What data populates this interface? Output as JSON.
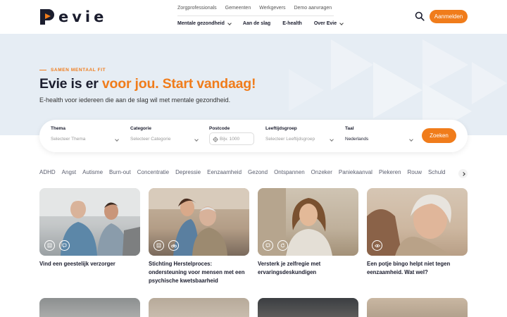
{
  "header": {
    "logo_text": "evie",
    "top_links": [
      "Zorgprofessionals",
      "Gemeenten",
      "Werkgevers",
      "Demo aanvragen"
    ],
    "main_nav": [
      {
        "label": "Mentale gezondheid",
        "has_dropdown": true
      },
      {
        "label": "Aan de slag",
        "has_dropdown": false
      },
      {
        "label": "E-health",
        "has_dropdown": false
      },
      {
        "label": "Over Evie",
        "has_dropdown": true
      }
    ],
    "search_icon": "search-icon",
    "signup_label": "Aanmelden"
  },
  "hero": {
    "eyebrow": "SAMEN MENTAAL FIT",
    "title_plain": "Evie is er ",
    "title_accent": "voor jou. Start vandaag!",
    "subtitle": "E-health voor iedereen die aan de slag wil met mentale gezondheid."
  },
  "search": {
    "fields": [
      {
        "label": "Thema",
        "placeholder": "Selecteer Thema"
      },
      {
        "label": "Categorie",
        "placeholder": "Selecteer Categorie"
      },
      {
        "label": "Postcode",
        "placeholder": "Bijv. 1000"
      },
      {
        "label": "Leeftijdsgroep",
        "placeholder": "Selecteer Leeftijdsgroep"
      },
      {
        "label": "Taal",
        "value": "Nederlands"
      }
    ],
    "button_label": "Zoeken"
  },
  "tags": [
    "ADHD",
    "Angst",
    "Autisme",
    "Burn-out",
    "Concentratie",
    "Depressie",
    "Eenzaamheid",
    "Gezond",
    "Ontspannen",
    "Onzeker",
    "Paniekaanval",
    "Piekeren",
    "Rouw",
    "Schuld"
  ],
  "cards": [
    {
      "title": "Vind een geestelijk verzorger",
      "icons": [
        "document-icon",
        "chat-icon"
      ]
    },
    {
      "title": "Stichting Herstelproces: ondersteuning voor mensen met een psychische kwetsbaarheid",
      "icons": [
        "document-icon",
        "bike-icon"
      ]
    },
    {
      "title": "Versterk je zelfregie met ervaringsdeskundigen",
      "icons": [
        "chat-icon",
        "refresh-icon"
      ]
    },
    {
      "title": "Een potje bingo helpt niet tegen eenzaamheid. Wat wel?",
      "icons": [
        "eye-icon"
      ]
    }
  ],
  "colors": {
    "accent": "#f07c1b",
    "hero_bg": "#e6edf4",
    "text": "#1b1d2e"
  }
}
